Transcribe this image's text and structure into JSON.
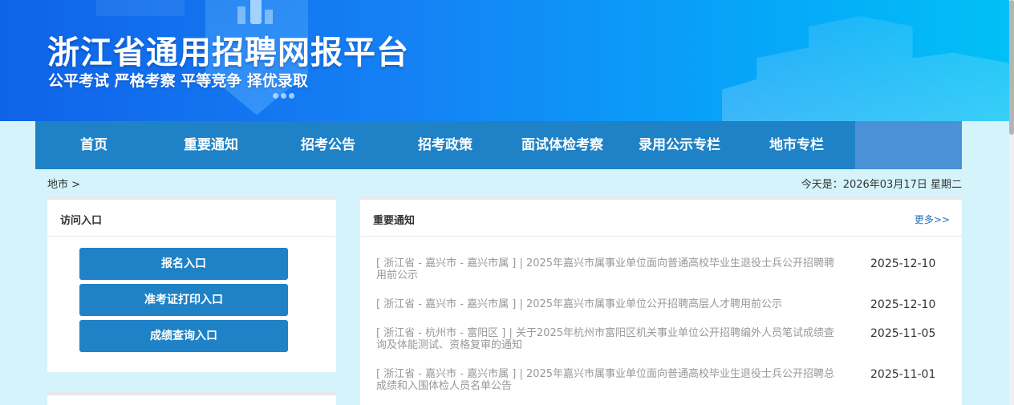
{
  "header": {
    "title": "浙江省通用招聘网报平台",
    "slogan": "公平考试 严格考察 平等竞争 择优录取"
  },
  "nav": {
    "items": [
      {
        "label": "首页"
      },
      {
        "label": "重要通知"
      },
      {
        "label": "招考公告"
      },
      {
        "label": "招考政策"
      },
      {
        "label": "面试体检考察"
      },
      {
        "label": "录用公示专栏"
      },
      {
        "label": "地市专栏"
      }
    ]
  },
  "breadcrumb": "地市 >",
  "today": "今天是：2026年03月17日 星期二",
  "access": {
    "title": "访问入口",
    "buttons": [
      {
        "label": "报名入口"
      },
      {
        "label": "准考证打印入口"
      },
      {
        "label": "成绩查询入口"
      }
    ]
  },
  "notices": {
    "title": "重要通知",
    "more": "更多>>",
    "items": [
      {
        "region": "[ 浙江省 - 嘉兴市 - 嘉兴市属 ]",
        "text": " | 2025年嘉兴市属事业单位面向普通高校毕业生退役士兵公开招聘聘用前公示",
        "date": "2025-12-10"
      },
      {
        "region": "[ 浙江省 - 嘉兴市 - 嘉兴市属 ]",
        "text": " | 2025年嘉兴市属事业单位公开招聘高层人才聘用前公示",
        "date": "2025-12-10"
      },
      {
        "region": "[ 浙江省 - 杭州市 - 富阳区 ]",
        "text": " | 关于2025年杭州市富阳区机关事业单位公开招聘编外人员笔试成绩查询及体能测试、资格复审的通知",
        "date": "2025-11-05"
      },
      {
        "region": "[ 浙江省 - 嘉兴市 - 嘉兴市属 ]",
        "text": " | 2025年嘉兴市属事业单位面向普通高校毕业生退役士兵公开招聘总成绩和入围体检人员名单公告",
        "date": "2025-11-01"
      }
    ]
  }
}
